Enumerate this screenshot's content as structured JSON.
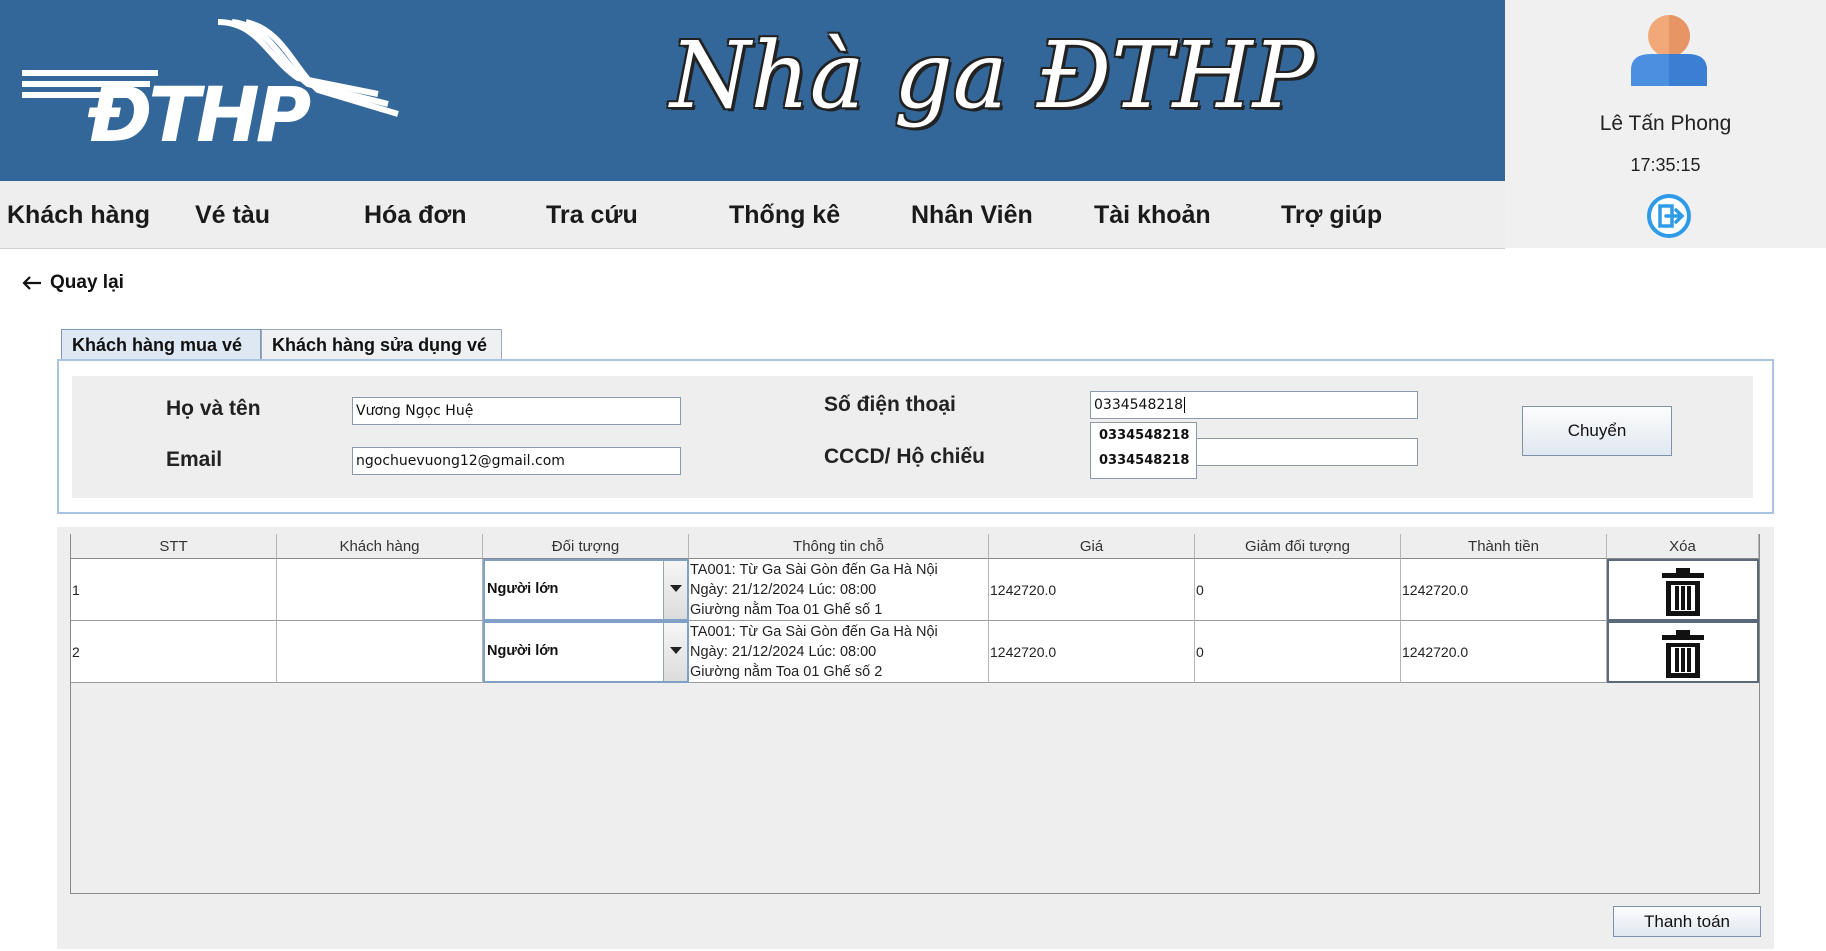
{
  "header": {
    "logo_text": "ĐTHP",
    "site_title": "Nhà ga ĐTHP"
  },
  "user": {
    "name": "Lê Tấn Phong",
    "time": "17:35:15"
  },
  "menu": [
    "Khách hàng",
    "Vé tàu",
    "Hóa đơn",
    "Tra cứu",
    "Thống kê",
    "Nhân Viên",
    "Tài khoản",
    "Trợ giúp"
  ],
  "back_label": "Quay lại",
  "tabs": [
    "Khách hàng mua vé",
    "Khách hàng sửa dụng vé"
  ],
  "form": {
    "name_label": "Họ và tên",
    "name_value": "Vương Ngọc Huệ",
    "email_label": "Email",
    "email_value": "ngochuevuong12@gmail.com",
    "phone_label": "Số điện thoại",
    "phone_value": "0334548218",
    "id_label": "CCCD/ Hộ chiếu",
    "id_value": "",
    "suggestions": [
      "0334548218",
      "0334548218"
    ],
    "transfer_button": "Chuyển"
  },
  "table": {
    "columns": [
      "STT",
      "Khách hàng",
      "Đối tượng",
      "Thông tin chỗ",
      "Giá",
      "Giảm đối tượng",
      "Thành tiền",
      "Xóa"
    ],
    "rows": [
      {
        "stt": "1",
        "customer": "",
        "type": "Người lớn",
        "info": [
          "TA001: Từ Ga Sài Gòn đến Ga Hà Nội",
          "Ngày: 21/12/2024   Lúc: 08:00",
          "Giường nằm Toa 01 Ghế số 1"
        ],
        "price": "1242720.0",
        "discount": "0",
        "total": "1242720.0"
      },
      {
        "stt": "2",
        "customer": "",
        "type": "Người lớn",
        "info": [
          "TA001: Từ Ga Sài Gòn đến Ga Hà Nội",
          "Ngày: 21/12/2024   Lúc: 08:00",
          "Giường nằm Toa 01 Ghế số 2"
        ],
        "price": "1242720.0",
        "discount": "0",
        "total": "1242720.0"
      }
    ]
  },
  "pay_button": "Thanh toán",
  "colors": {
    "banner": "#336699",
    "accent": "#2f9be8"
  }
}
